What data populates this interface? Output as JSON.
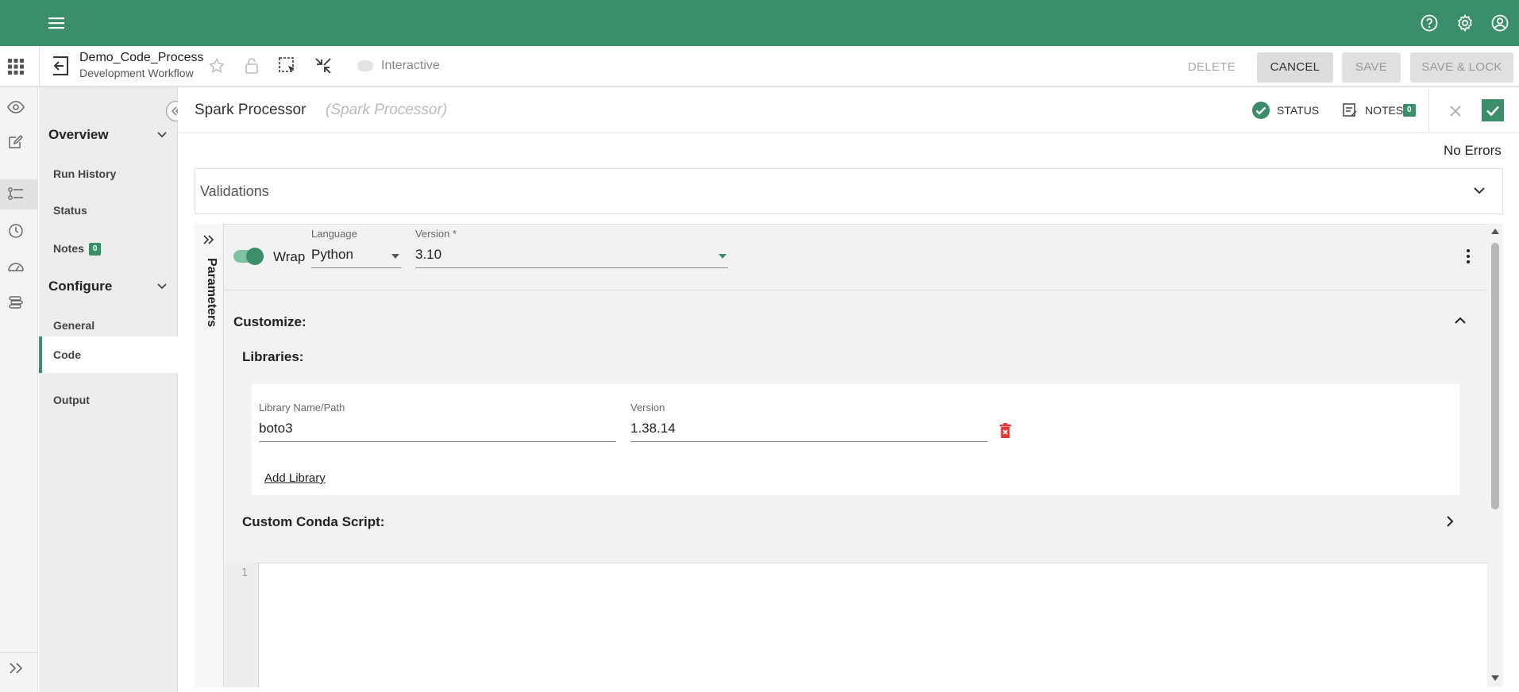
{
  "workflow": {
    "name": "Demo_Code_Process",
    "subtitle": "Development Workflow",
    "interactive_label": "Interactive"
  },
  "actions": {
    "delete": "DELETE",
    "cancel": "CANCEL",
    "save": "SAVE",
    "save_lock": "SAVE & LOCK"
  },
  "sidebar": {
    "overview": "Overview",
    "items1": [
      {
        "label": "Run History"
      },
      {
        "label": "Status"
      },
      {
        "label": "Notes",
        "badge": "0"
      }
    ],
    "configure": "Configure",
    "items2": [
      {
        "label": "General"
      },
      {
        "label": "Code"
      },
      {
        "label": "Output"
      }
    ]
  },
  "panel": {
    "title": "Spark Processor",
    "type": "(Spark Processor)",
    "status_label": "STATUS",
    "notes_label": "NOTES",
    "notes_count": "0",
    "errors": "No Errors",
    "validations": "Validations"
  },
  "editor": {
    "tab_label": "Parameters",
    "wrap_label": "Wrap",
    "language_label": "Language",
    "language_value": "Python",
    "version_label": "Version *",
    "version_value": "3.10",
    "customize": "Customize:",
    "libraries": "Libraries:",
    "lib_name_label": "Library Name/Path",
    "lib_name_value": "boto3",
    "lib_version_label": "Version",
    "lib_version_value": "1.38.14",
    "add_library": "Add Library",
    "conda": "Custom Conda Script:",
    "line_number": "1"
  },
  "colors": {
    "brand": "#3a8f6a",
    "danger": "#e53935"
  }
}
